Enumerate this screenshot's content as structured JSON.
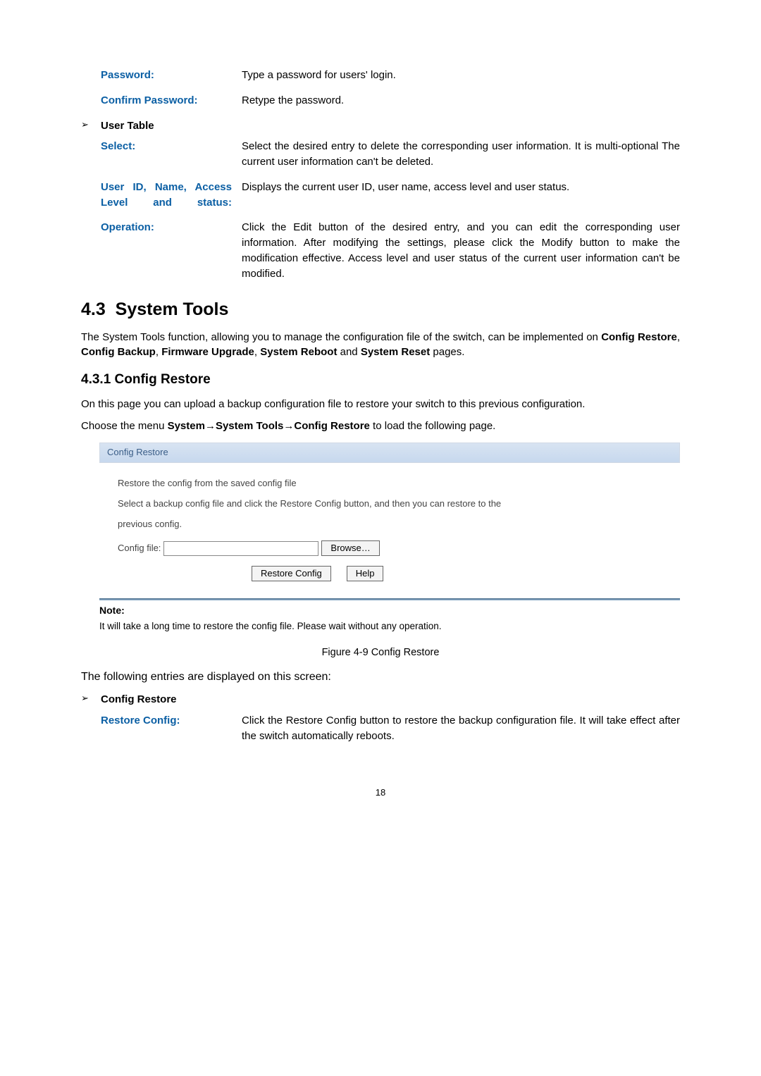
{
  "defs1": {
    "password_label": "Password:",
    "password_desc": "Type a password for users' login.",
    "confirm_label": "Confirm Password:",
    "confirm_desc": "Retype the password."
  },
  "bullet1_label": "User Table",
  "defs2": {
    "select_label": "Select:",
    "select_desc": "Select the desired entry to delete the corresponding user information. It is multi-optional The current user information can't be deleted.",
    "usercols_label": "User ID, Name, Access Level and status:",
    "usercols_desc": "Displays the current user ID, user name, access level and user status.",
    "operation_label": "Operation:",
    "operation_desc": "Click the Edit button of the desired entry, and you can edit the corresponding user information. After modifying the settings, please click the Modify button to make the modification effective. Access level and user status of the current user information can't be modified."
  },
  "sec_number": "4.3",
  "sec_title": "System Tools",
  "sec_para_pre": "The System Tools function, allowing you to manage the configuration file of the switch, can be implemented on ",
  "sec_bold_list": [
    "Config Restore",
    "Config Backup",
    "Firmware Upgrade",
    "System Reboot",
    "System Reset"
  ],
  "sec_para_mid_joiners": [
    ", ",
    ", ",
    ", ",
    " and "
  ],
  "sec_para_post": " pages.",
  "sub_title": "4.3.1 Config Restore",
  "sub_para1": "On this page you can upload a backup configuration file to restore your switch to this previous configuration.",
  "sub_para2_pre": "Choose the menu ",
  "sub_para2_menu": [
    "System",
    "System Tools",
    "Config Restore"
  ],
  "sub_para2_post": " to load the following page.",
  "panel": {
    "header": "Config Restore",
    "line1": "Restore the config from the saved config file",
    "line2": "Select a backup config file and click the Restore Config button, and then you can restore to the",
    "line3": "previous config.",
    "file_label": "Config file:",
    "browse_btn": "Browse…",
    "restore_btn": "Restore Config",
    "help_btn": "Help"
  },
  "note_title": "Note:",
  "note_text": "It will take a long time to restore the config file. Please wait without any operation.",
  "caption": "Figure 4-9 Config Restore",
  "entries_intro": "The following entries are displayed on this screen:",
  "bullet2_label": "Config Restore",
  "defs3": {
    "restore_label": "Restore Config:",
    "restore_desc": "Click the Restore Config button to restore the backup configuration file. It will take effect after the switch automatically reboots."
  },
  "page_number": "18"
}
